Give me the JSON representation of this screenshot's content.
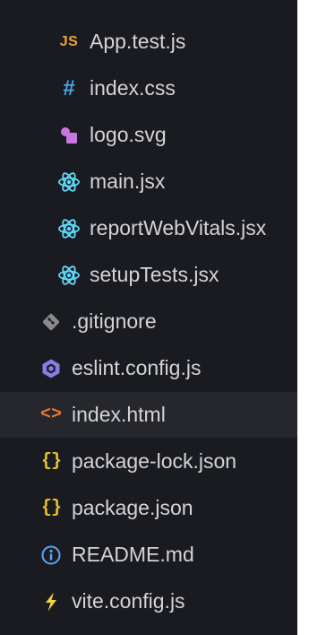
{
  "explorer": {
    "files": [
      {
        "name": "App.test.js",
        "icon": "javascript-file-icon",
        "indent": 1
      },
      {
        "name": "index.css",
        "icon": "css-file-icon",
        "indent": 1
      },
      {
        "name": "logo.svg",
        "icon": "svg-file-icon",
        "indent": 1
      },
      {
        "name": "main.jsx",
        "icon": "react-file-icon",
        "indent": 1
      },
      {
        "name": "reportWebVitals.jsx",
        "icon": "react-file-icon",
        "indent": 1
      },
      {
        "name": "setupTests.jsx",
        "icon": "react-file-icon",
        "indent": 1
      },
      {
        "name": ".gitignore",
        "icon": "git-file-icon",
        "indent": 0
      },
      {
        "name": "eslint.config.js",
        "icon": "eslint-file-icon",
        "indent": 0
      },
      {
        "name": "index.html",
        "icon": "html-file-icon",
        "indent": 0
      },
      {
        "name": "package-lock.json",
        "icon": "json-file-icon",
        "indent": 0
      },
      {
        "name": "package.json",
        "icon": "json-file-icon",
        "indent": 0
      },
      {
        "name": "README.md",
        "icon": "info-file-icon",
        "indent": 0
      },
      {
        "name": "vite.config.js",
        "icon": "vite-file-icon",
        "indent": 0
      }
    ],
    "icon_glyphs": {
      "js": "JS",
      "css": "#",
      "json": "{}",
      "html": "<>"
    },
    "colors": {
      "background": "#1a1b20",
      "hover_background": "#26272c",
      "text": "#d4d4d4",
      "js": "#e8a43a",
      "css": "#47a8e3",
      "react": "#61dafb",
      "svg_icon": "#c678dd",
      "git": "#8a8a8a",
      "eslint": "#8b7be6",
      "html": "#e8743a",
      "json": "#e6c229",
      "info": "#5ba8f5",
      "vite": "#f5d13f"
    }
  }
}
